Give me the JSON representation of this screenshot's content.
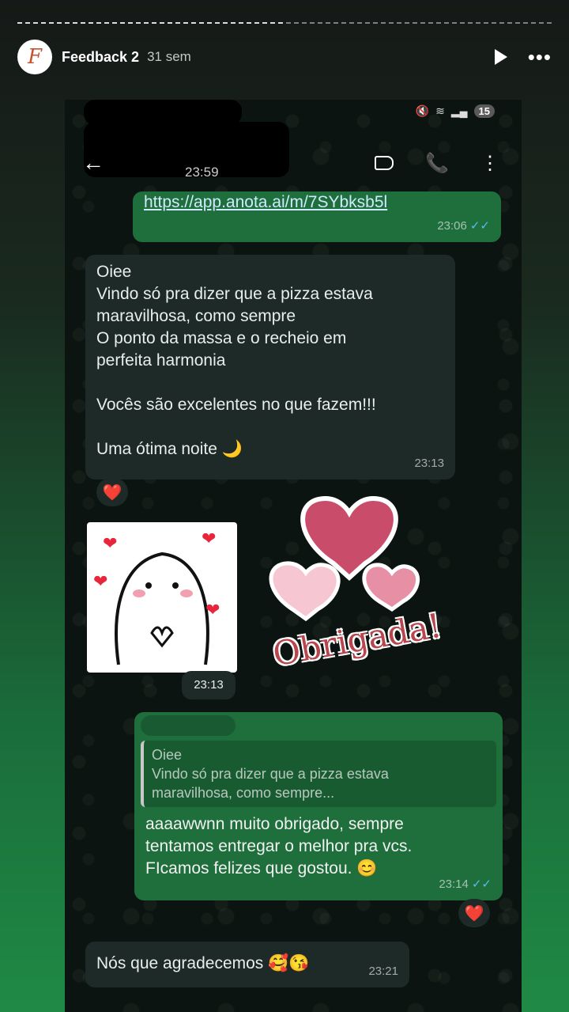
{
  "story": {
    "name": "Feedback 2",
    "time": "31 sem",
    "avatar_letter": "F"
  },
  "status_bar": {
    "battery": "15"
  },
  "chat": {
    "last_seen": "23:59",
    "messages": [
      {
        "link": "https://app.anota.ai/m/7SYbksb5l",
        "time": "23:06"
      },
      {
        "lines": [
          "Oiee",
          "Vindo só pra dizer que a pizza estava",
          "maravilhosa, como sempre",
          "O ponto da massa e o recheio em",
          "perfeita harmonia",
          "",
          "Vocês são excelentes no que fazem!!!",
          "",
          "Uma ótima noite 🌙"
        ],
        "time": "23:13"
      },
      {
        "sticker_time": "23:13",
        "sticker_text": "Obrigada!"
      },
      {
        "quote_author": "Oiee",
        "quote_lines": [
          "Vindo só pra dizer que a pizza estava",
          "maravilhosa, como sempre..."
        ],
        "reply_lines": [
          "aaaawwnn muito obrigado, sempre",
          "tentamos entregar o melhor pra vcs.",
          "FIcamos felizes que gostou. 😊"
        ],
        "time": "23:14"
      },
      {
        "text": "Nós que agradecemos 🥰😘",
        "time": "23:21"
      }
    ]
  },
  "reaction": "❤️"
}
